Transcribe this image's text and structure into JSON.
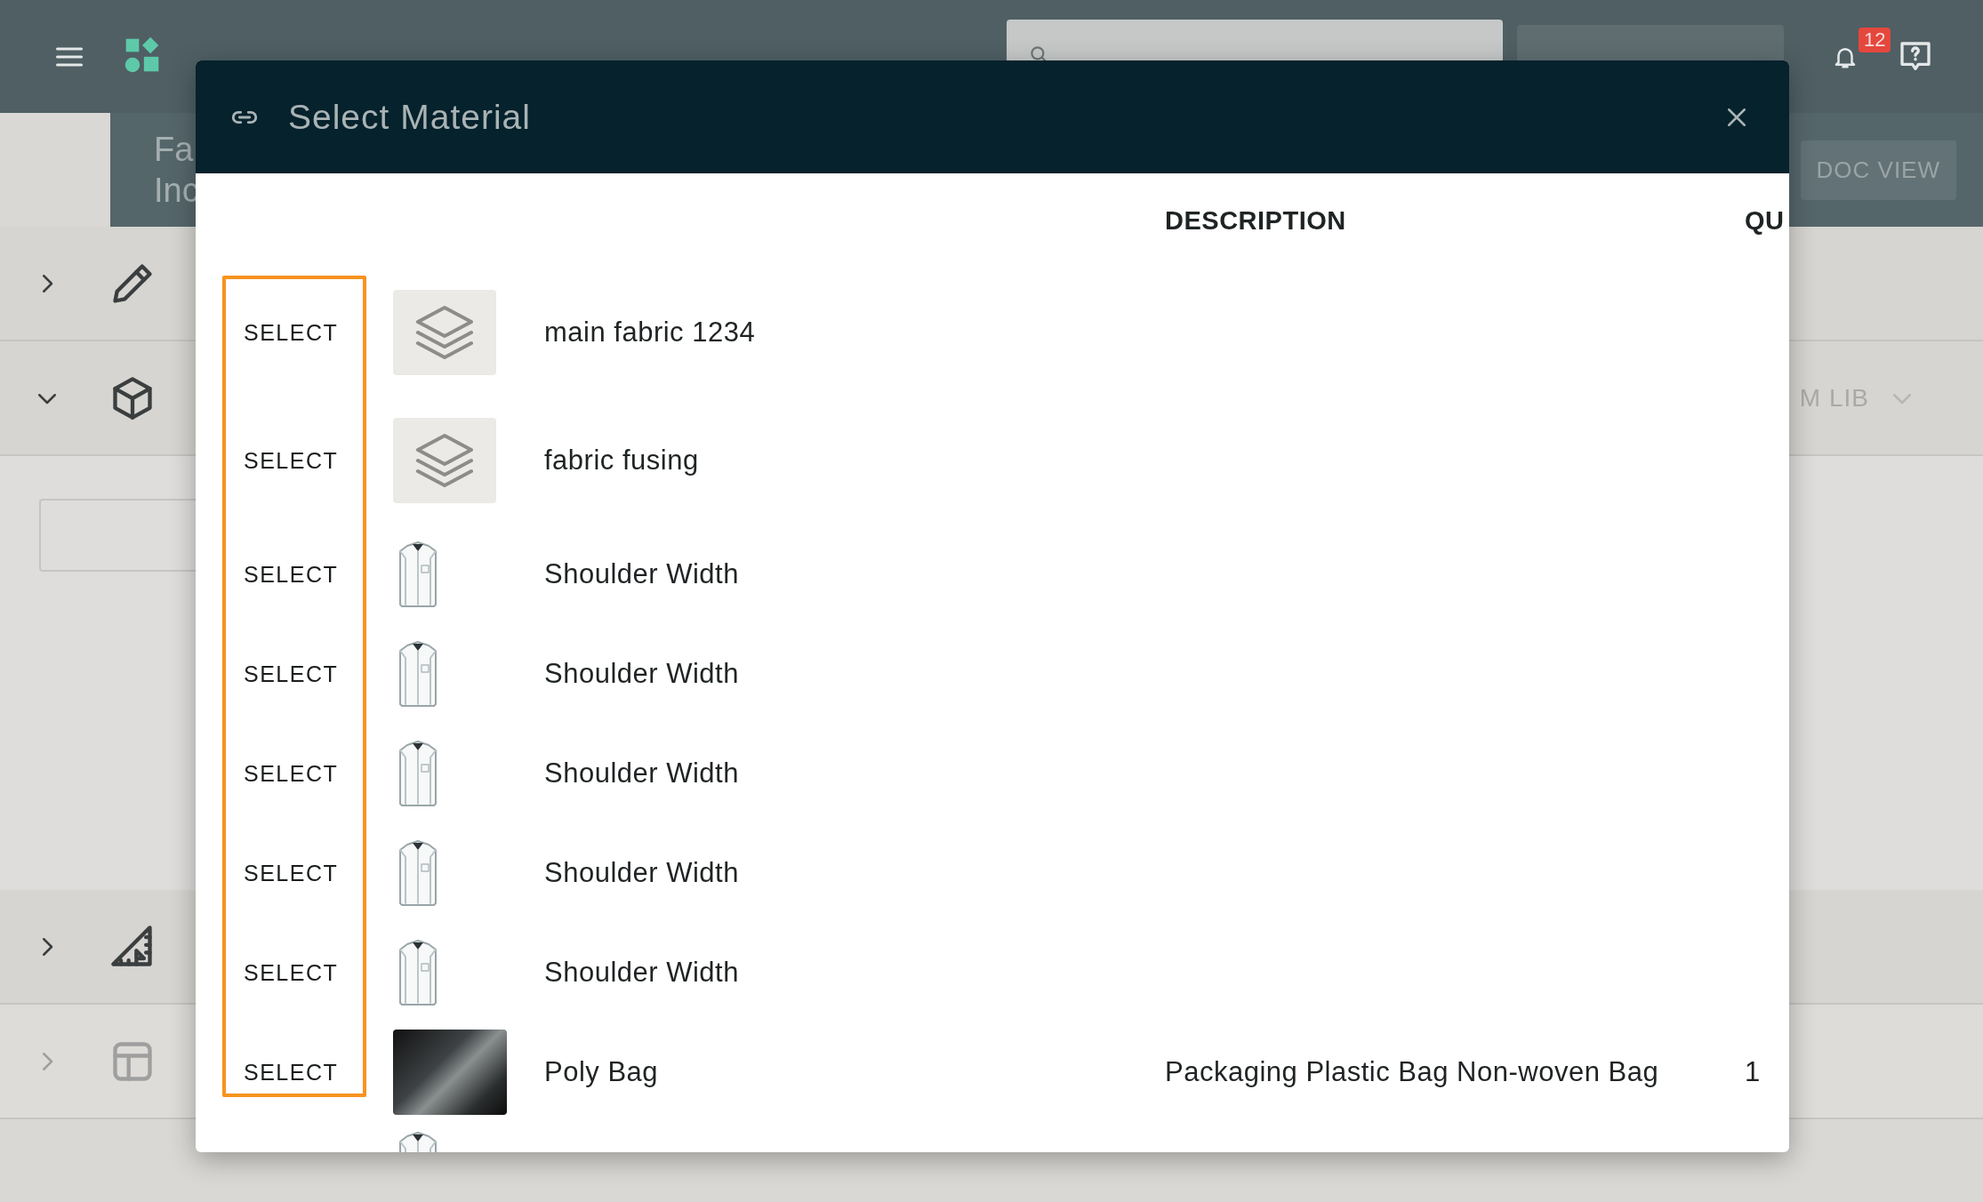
{
  "top_bar": {
    "notification_count": "12"
  },
  "page_header": {
    "title_lines": [
      "Fa",
      "Inc"
    ],
    "doc_view": "DOC VIEW"
  },
  "sections": [
    {
      "kind": "pencil",
      "expanded": false,
      "disabled": false
    },
    {
      "kind": "cube",
      "action": "M LIB",
      "expanded": true,
      "disabled": false
    },
    {
      "kind": "ruler",
      "expanded": false,
      "disabled": false
    },
    {
      "kind": "layout",
      "expanded": false,
      "disabled": true
    }
  ],
  "modal": {
    "title": "Select Material",
    "columns": [
      "DESCRIPTION",
      "QU"
    ],
    "rows": [
      {
        "select": "SELECT",
        "kind": "material",
        "name": "main fabric 1234"
      },
      {
        "select": "SELECT",
        "kind": "material",
        "name": "fabric fusing"
      },
      {
        "select": "SELECT",
        "kind": "shirt",
        "name": "Shoulder Width"
      },
      {
        "select": "SELECT",
        "kind": "shirt",
        "name": "Shoulder Width"
      },
      {
        "select": "SELECT",
        "kind": "shirt",
        "name": "Shoulder Width"
      },
      {
        "select": "SELECT",
        "kind": "shirt",
        "name": "Shoulder Width"
      },
      {
        "select": "SELECT",
        "kind": "shirt",
        "name": "Shoulder Width"
      },
      {
        "select": "SELECT",
        "kind": "photo",
        "name": "Poly Bag",
        "description": "Packaging Plastic Bag Non-woven Bag",
        "quantity": "1"
      },
      {
        "kind": "shirt"
      }
    ]
  }
}
